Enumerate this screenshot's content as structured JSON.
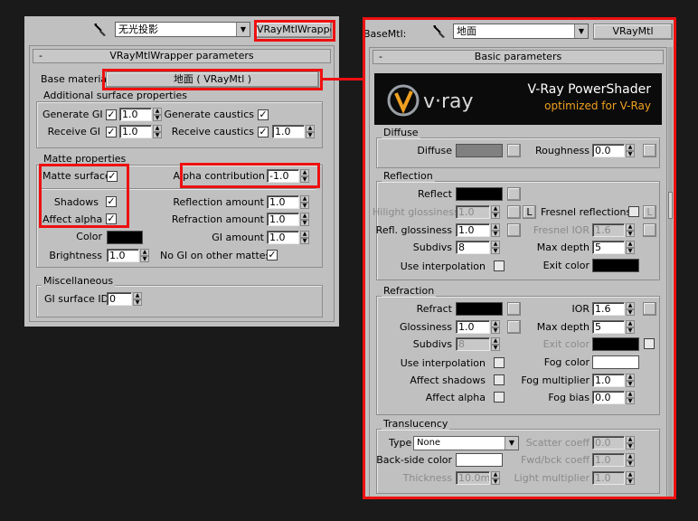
{
  "left": {
    "material_name": "无光投影",
    "type_button": "VRayMtlWrapper",
    "rollout_title": "VRayMtlWrapper parameters",
    "base_material_label": "Base material:",
    "base_material_value": "地面  ( VRayMtl )",
    "additional": {
      "title": "Additional surface properties",
      "generate_gi": "Generate GI",
      "generate_gi_val": "1.0",
      "receive_gi": "Receive GI",
      "receive_gi_val": "1.0",
      "generate_caustics": "Generate caustics",
      "receive_caustics": "Receive caustics",
      "receive_caustics_val": "1.0"
    },
    "matte": {
      "title": "Matte properties",
      "matte_surface": "Matte surface",
      "alpha_contribution": "Alpha contribution",
      "alpha_contribution_val": "-1.0",
      "shadows": "Shadows",
      "affect_alpha": "Affect alpha",
      "reflection_amount": "Reflection amount",
      "reflection_amount_val": "1.0",
      "refraction_amount": "Refraction amount",
      "refraction_amount_val": "1.0",
      "color": "Color",
      "gi_amount": "GI amount",
      "gi_amount_val": "1.0",
      "brightness": "Brightness",
      "brightness_val": "1.0",
      "no_gi_other": "No GI on other mattes"
    },
    "misc": {
      "title": "Miscellaneous",
      "gi_surface_id": "GI surface ID",
      "gi_surface_id_val": "0"
    }
  },
  "right": {
    "basemtl_label": "BaseMtl:",
    "material_name": "地面",
    "type_button": "VRayMtl",
    "rollout_title": "Basic parameters",
    "banner_title": "V-Ray PowerShader",
    "banner_sub": "optimized for V-Ray",
    "diffuse": {
      "title": "Diffuse",
      "diffuse": "Diffuse",
      "roughness": "Roughness",
      "roughness_val": "0.0"
    },
    "reflection": {
      "title": "Reflection",
      "reflect": "Reflect",
      "hilight": "Hilight glossiness",
      "hilight_val": "1.0",
      "lock": "L",
      "fresnel": "Fresnel reflections",
      "refl_gloss": "Refl. glossiness",
      "refl_gloss_val": "1.0",
      "fresnel_ior": "Fresnel IOR",
      "fresnel_ior_val": "1.6",
      "subdivs": "Subdivs",
      "subdivs_val": "8",
      "max_depth": "Max depth",
      "max_depth_val": "5",
      "use_interp": "Use interpolation",
      "exit_color": "Exit color"
    },
    "refraction": {
      "title": "Refraction",
      "refract": "Refract",
      "ior": "IOR",
      "ior_val": "1.6",
      "glossiness": "Glossiness",
      "glossiness_val": "1.0",
      "max_depth": "Max depth",
      "max_depth_val": "5",
      "subdivs": "Subdivs",
      "subdivs_val": "8",
      "exit_color": "Exit color",
      "use_interp": "Use interpolation",
      "fog_color": "Fog color",
      "affect_shadows": "Affect shadows",
      "fog_multiplier": "Fog multiplier",
      "fog_multiplier_val": "1.0",
      "affect_alpha": "Affect alpha",
      "fog_bias": "Fog bias",
      "fog_bias_val": "0.0"
    },
    "translucency": {
      "title": "Translucency",
      "type": "Type",
      "type_val": "None",
      "scatter_coeff": "Scatter coeff",
      "scatter_coeff_val": "0.0",
      "backside": "Back-side color",
      "fwd_bck": "Fwd/bck coeff",
      "fwd_bck_val": "1.0",
      "thickness": "Thickness",
      "thickness_val": "10.0m",
      "light_mult": "Light multiplier",
      "light_mult_val": "1.0"
    }
  },
  "colors": {
    "highlight_box": "#ee1010",
    "matte_color": "#000000",
    "diffuse_color": "#808080",
    "reflect_color": "#000000",
    "exit_color": "#000000",
    "refract_color": "#000000",
    "fog_color": "#ffffff",
    "backside_color": "#ffffff",
    "banner_bg": "#0b0b0b",
    "banner_title_color": "#ffffff",
    "banner_sub_color": "#f0a020"
  }
}
